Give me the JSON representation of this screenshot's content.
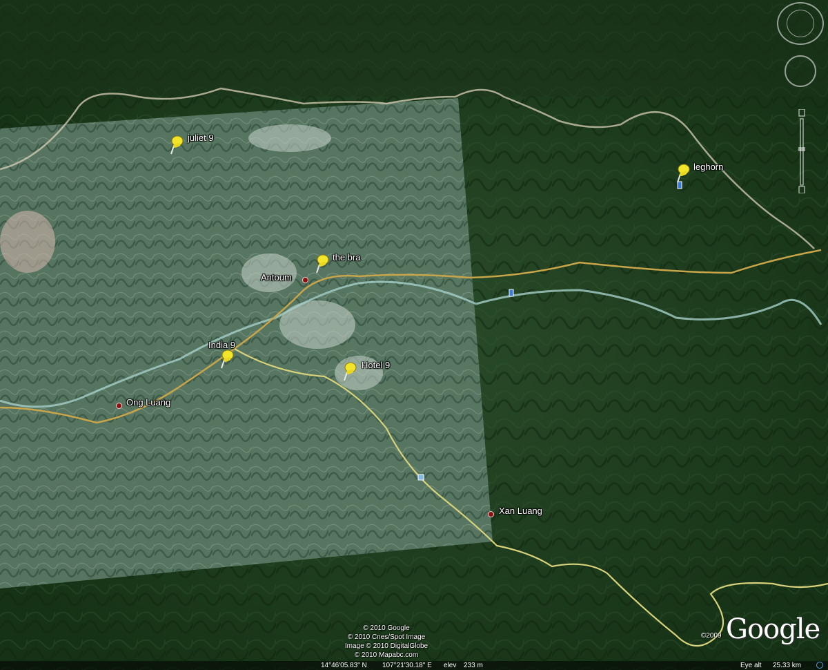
{
  "placemarks": [
    {
      "label": "juliet 9",
      "type": "pushpin"
    },
    {
      "label": "leghorn",
      "type": "pushpin"
    },
    {
      "label": "the bra",
      "type": "pushpin"
    },
    {
      "label": "India 9",
      "type": "pushpin"
    },
    {
      "label": "Hotel 9",
      "type": "pushpin"
    }
  ],
  "places": [
    {
      "label": "Antoum"
    },
    {
      "label": "Ong Luang"
    },
    {
      "label": "Xan Luang"
    }
  ],
  "attribution": {
    "line1": "© 2010 Google",
    "line2": "© 2010 Cnes/Spot Image",
    "line3": "Image © 2010 DigitalGlobe",
    "line4": "© 2010 Mapabc.com"
  },
  "status": {
    "latitude": "14°46'05.83\" N",
    "longitude": "107°21'30.18\" E",
    "elevation_label": "elev",
    "elevation": "233 m",
    "eye_alt_label": "Eye alt",
    "eye_alt": "25.33 km"
  },
  "logo": {
    "text": "Google",
    "copyright": "©2009"
  },
  "colors": {
    "forest": "#1c3a1c",
    "overlay_tile": "#6b8a74",
    "road_major": "#c9a54a",
    "road_minor": "#d9d27a",
    "river": "#9ec8c4",
    "pushpin": "#f2e52a"
  },
  "icons": [
    "pushpin-icon",
    "place-dot-icon",
    "navigation-compass-icon",
    "look-joystick-icon",
    "zoom-slider-icon",
    "hiker-icon"
  ]
}
